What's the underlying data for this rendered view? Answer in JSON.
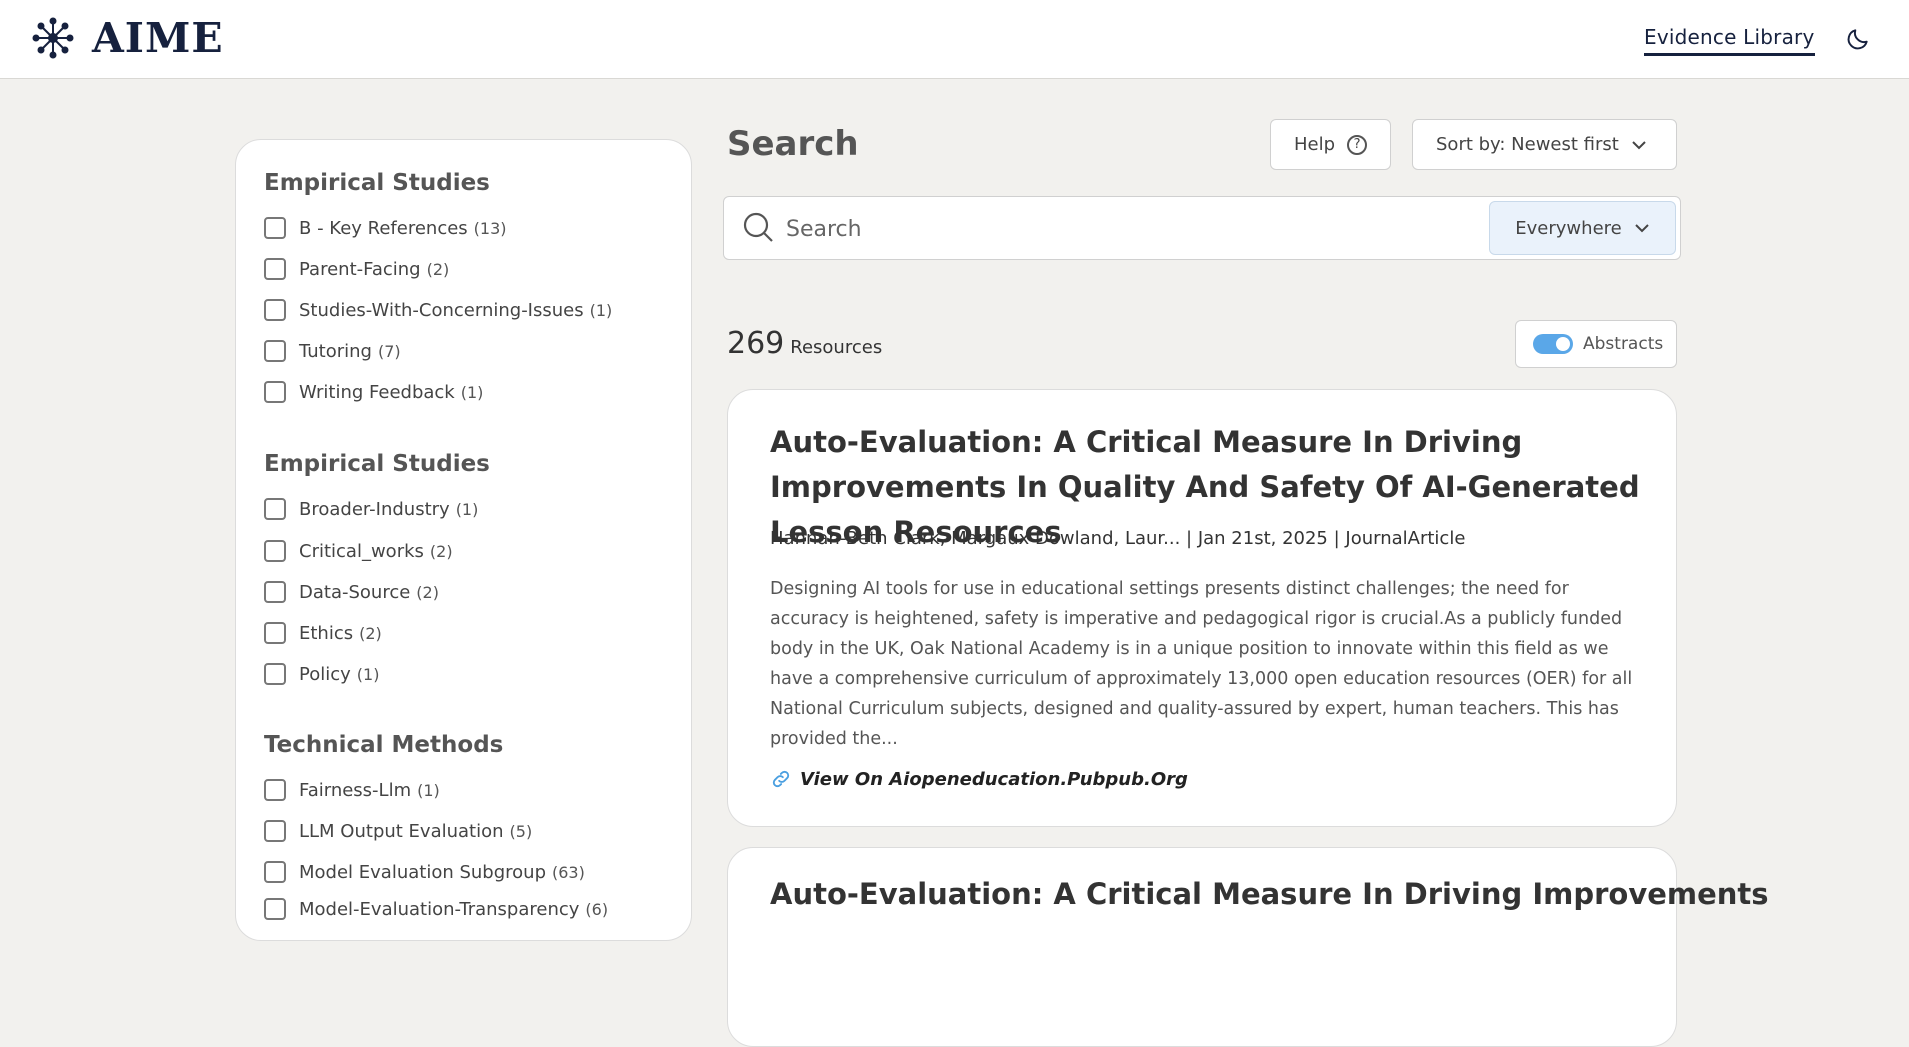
{
  "header": {
    "logo_text": "AIME",
    "nav_link": "Evidence Library",
    "theme_icon": "moon-icon"
  },
  "sidebar": {
    "groups": [
      {
        "title": "Empirical Studies",
        "items": [
          {
            "label": "B - Key References",
            "count": "(13)"
          },
          {
            "label": "Parent-Facing",
            "count": "(2)"
          },
          {
            "label": "Studies-With-Concerning-Issues",
            "count": "(1)"
          },
          {
            "label": "Tutoring",
            "count": "(7)"
          },
          {
            "label": "Writing Feedback",
            "count": "(1)"
          }
        ]
      },
      {
        "title": "Empirical Studies",
        "items": [
          {
            "label": "Broader-Industry",
            "count": "(1)"
          },
          {
            "label": "Critical_works",
            "count": "(2)"
          },
          {
            "label": "Data-Source",
            "count": "(2)"
          },
          {
            "label": "Ethics",
            "count": "(2)"
          },
          {
            "label": "Policy",
            "count": "(1)"
          }
        ]
      },
      {
        "title": "Technical Methods",
        "items": [
          {
            "label": "Fairness-Llm",
            "count": "(1)"
          },
          {
            "label": "LLM Output Evaluation",
            "count": "(5)"
          },
          {
            "label": "Model Evaluation Subgroup",
            "count": "(63)"
          },
          {
            "label": "Model-Evaluation-Transparency",
            "count": "(6)"
          }
        ]
      }
    ]
  },
  "main": {
    "title": "Search",
    "help_label": "Help",
    "help_icon_glyph": "?",
    "sort_label": "Sort by: Newest first",
    "search": {
      "placeholder": "Search",
      "value": ""
    },
    "scope_label": "Everywhere",
    "results_count": "269",
    "results_label": "Resources",
    "abstracts_label": "Abstracts",
    "abstracts_enabled": true
  },
  "results": [
    {
      "title": "Auto-Evaluation: A Critical Measure In Driving Improvements In Quality And Safety Of AI-Generated Lesson Resources",
      "meta": "Hannah-Beth Clark, Margaux Dowland, Laur...  |  Jan 21st, 2025  |  JournalArticle",
      "abstract": "Designing AI tools for use in educational settings presents distinct challenges; the need for accuracy is heightened, safety is imperative and pedagogical rigor is crucial.As a publicly funded body in the UK, Oak National Academy is in a unique position to innovate within this field as we have a comprehensive curriculum of approximately 13,000 open education resources (OER) for all National Curriculum subjects, designed and quality-assured by expert, human teachers. This has provided the...",
      "link": "View On Aiopeneducation.Pubpub.Org"
    },
    {
      "title": "Auto-Evaluation: A Critical Measure In Driving Improvements"
    }
  ],
  "colors": {
    "background": "#f2f1ee",
    "brand_navy": "#16213e",
    "toggle_accent": "#5aa7e8",
    "scope_bg": "#eaf2fb"
  }
}
